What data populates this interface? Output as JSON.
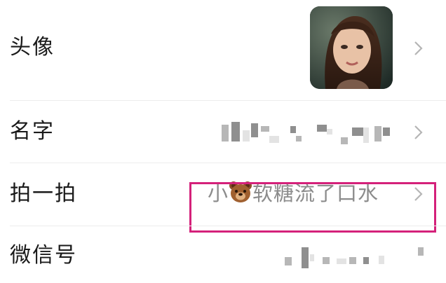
{
  "rows": [
    {
      "label": "头像",
      "icon": "chevron-right-icon"
    },
    {
      "label": "名字",
      "value_redacted": true,
      "icon": "chevron-right-icon"
    },
    {
      "label": "拍一拍",
      "value": "小🐻软糖流了口水",
      "value_prefix": "小",
      "value_emoji": "bear-emoji",
      "value_suffix": "软糖流了口水",
      "icon": "chevron-right-icon"
    },
    {
      "label": "微信号",
      "value_redacted": true
    }
  ],
  "highlight_color": "#d4217a"
}
